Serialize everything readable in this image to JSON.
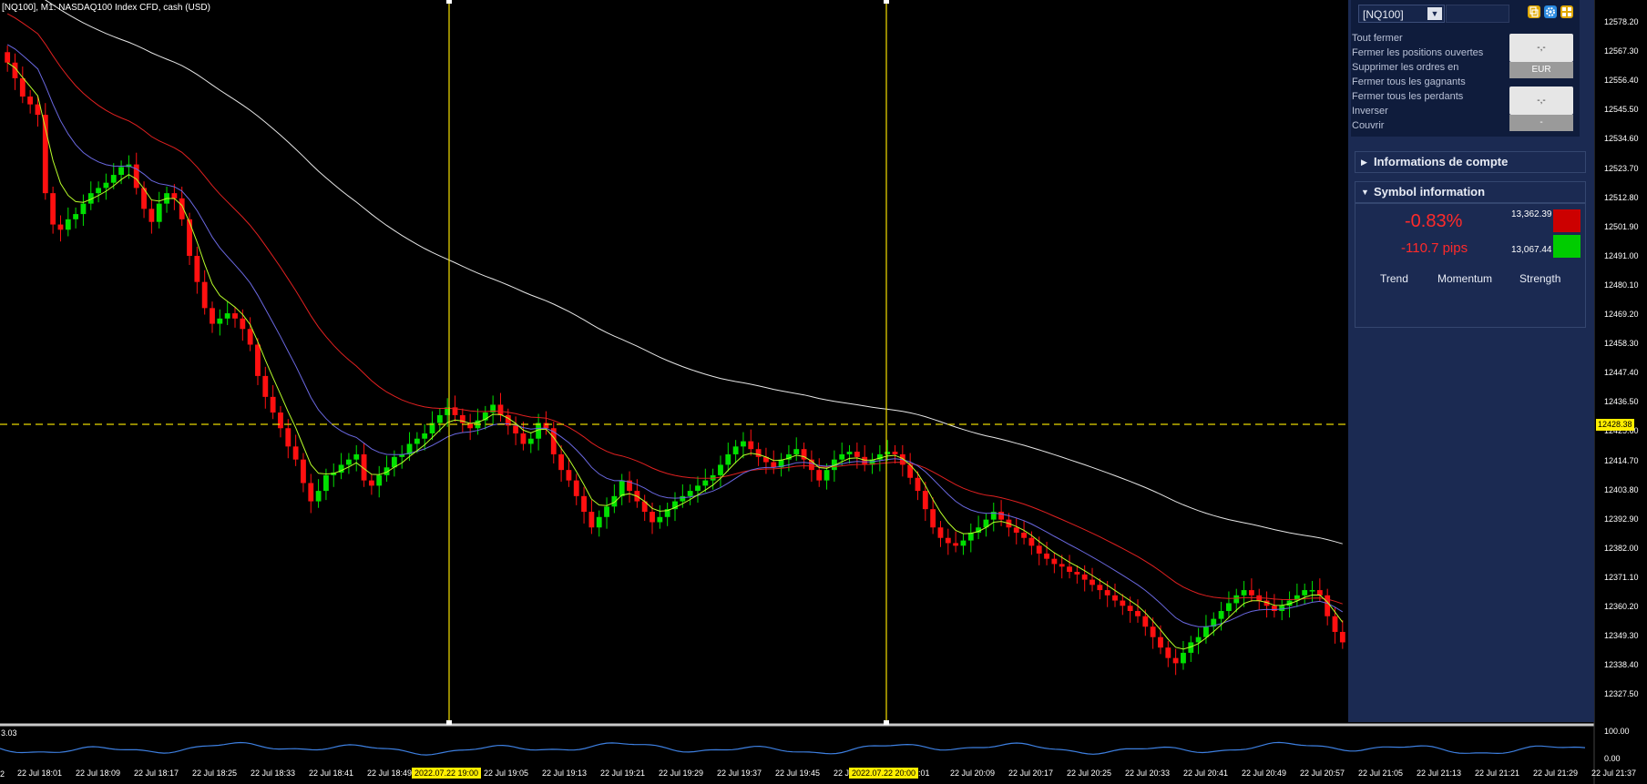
{
  "window": {
    "title": "[NQ100], M1:  NASDAQ100 Index CFD, cash (USD)",
    "left_edge_label": "2"
  },
  "price_axis": {
    "labels": [
      "12578.20",
      "12567.30",
      "12556.40",
      "12545.50",
      "12534.60",
      "12523.70",
      "12512.80",
      "12501.90",
      "12491.00",
      "12480.10",
      "12469.20",
      "12458.30",
      "12447.40",
      "12436.50",
      "12425.60",
      "12414.70",
      "12403.80",
      "12392.90",
      "12382.00",
      "12371.10",
      "12360.20",
      "12349.30",
      "12338.40",
      "12327.50"
    ],
    "current_price": "12428.38"
  },
  "time_axis": {
    "labels": [
      "22 Jul 18:01",
      "22 Jul 18:09",
      "22 Jul 18:17",
      "22 Jul 18:25",
      "22 Jul 18:33",
      "22 Jul 18:41",
      "22 Jul 18:49",
      "22 Jul 19:05",
      "22 Jul 19:13",
      "22 Jul 19:21",
      "22 Jul 19:29",
      "22 Jul 19:37",
      "22 Jul 19:45",
      "22 J",
      "22 Jul 20:09",
      "22 Jul 20:17",
      "22 Jul 20:25",
      "22 Jul 20:33",
      "22 Jul 20:41",
      "22 Jul 20:49",
      "22 Jul 20:57",
      "22 Jul 21:05",
      "22 Jul 21:13",
      "22 Jul 21:21",
      "22 Jul 21:29",
      "22 Jul 21:37"
    ],
    "partial_label": "0:01",
    "vline_tags": [
      "2022.07.22 19:00",
      "2022.07.22 20:00"
    ]
  },
  "oscillator": {
    "left_value": "3.03",
    "max_label": "100.00",
    "min_label": "0.00"
  },
  "panel": {
    "symbol": "[NQ100]",
    "dropdown_glyph": "▼",
    "menu": [
      "Tout fermer",
      "Fermer les positions ouvertes",
      "Supprimer les ordres en",
      "Fermer tous les gagnants",
      "Fermer tous les perdants",
      "Inverser",
      "Couvrir"
    ],
    "button1_value": "-,-",
    "button1_currency": "EUR",
    "button2_value": "-,-",
    "button2_sub": "-",
    "account_info_label": "Informations de compte",
    "symbol_info_label": "Symbol information",
    "change_pct": "-0.83%",
    "change_pips": "-110.7 pips",
    "high": "13,362.39",
    "low": "13,067.44",
    "metrics": [
      "Trend",
      "Momentum",
      "Strength"
    ],
    "colors": {
      "high": "#cc0000",
      "low": "#00cc00"
    }
  },
  "chart_data": {
    "type": "candlestick",
    "price_range": [
      12320,
      12585
    ],
    "closes": [
      12568,
      12562,
      12555,
      12552,
      12548,
      12518,
      12506,
      12504,
      12508,
      12510,
      12514,
      12518,
      12520,
      12522,
      12525,
      12528,
      12529,
      12520,
      12512,
      12507,
      12514,
      12518,
      12516,
      12508,
      12494,
      12484,
      12474,
      12468,
      12470,
      12472,
      12470,
      12466,
      12460,
      12448,
      12440,
      12434,
      12428,
      12421,
      12416,
      12407,
      12400,
      12404,
      12410,
      12411,
      12414,
      12416,
      12418,
      12408,
      12406,
      12410,
      12413,
      12417,
      12418,
      12422,
      12424,
      12426,
      12430,
      12433,
      12436,
      12433,
      12430,
      12428,
      12431,
      12434,
      12437,
      12433,
      12429,
      12426,
      12422,
      12424,
      12430,
      12428,
      12418,
      12412,
      12408,
      12402,
      12396,
      12390,
      12394,
      12398,
      12402,
      12408,
      12404,
      12400,
      12396,
      12392,
      12394,
      12397,
      12400,
      12402,
      12404,
      12406,
      12408,
      12410,
      12414,
      12418,
      12421,
      12423,
      12420,
      12417,
      12415,
      12413,
      12416,
      12418,
      12420,
      12416,
      12412,
      12408,
      12412,
      12416,
      12418,
      12419,
      12417,
      12414,
      12416,
      12418,
      12419,
      12418,
      12414,
      12409,
      12404,
      12397,
      12390,
      12386,
      12384,
      12383,
      12385,
      12388,
      12390,
      12393,
      12396,
      12393,
      12390,
      12388,
      12386,
      12383,
      12380,
      12378,
      12376,
      12375,
      12373,
      12372,
      12370,
      12368,
      12366,
      12364,
      12362,
      12360,
      12358,
      12356,
      12352,
      12348,
      12344,
      12340,
      12338,
      12342,
      12346,
      12348,
      12352,
      12355,
      12358,
      12361,
      12364,
      12366,
      12364,
      12362,
      12360,
      12358,
      12360,
      12362,
      12364,
      12366,
      12366,
      12364,
      12356,
      12350,
      12346
    ]
  }
}
